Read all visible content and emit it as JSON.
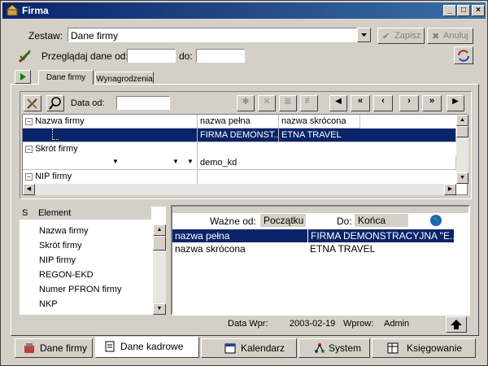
{
  "window": {
    "title": "Firma",
    "controls": [
      "minimize-icon",
      "maximize-icon",
      "close-icon"
    ]
  },
  "toolbar": {
    "zestaw_label": "Zestaw:",
    "zestaw_value": "Dane firmy",
    "save_label": "Zapisz",
    "cancel_label": "Anuluj",
    "browse_label": "Przeglądaj dane od:",
    "browse_from": "",
    "do_label": "do:",
    "browse_to": ""
  },
  "tabs": [
    "Dane firmy",
    "Wynagrodzenia"
  ],
  "inner_toolbar": {
    "data_od_label": "Data od:",
    "data_od_value": ""
  },
  "nav_buttons": [
    "first",
    "prev-page",
    "prev",
    "next",
    "next-page",
    "last"
  ],
  "tree": [
    {
      "label": "Nazwa firmy"
    },
    {
      "label": "Skrót firmy"
    },
    {
      "label": "NIP firmy"
    }
  ],
  "grid": {
    "columns": [
      "nazwa pełna",
      "nazwa skrócona"
    ],
    "rows": [
      {
        "full": "FIRMA DEMONST...",
        "short": "ETNA TRAVEL"
      },
      {
        "full": "demo_kd",
        "short": ""
      }
    ]
  },
  "element_list": {
    "col_s": "S",
    "col_element": "Element",
    "items": [
      "Nazwa firmy",
      "Skrót firmy",
      "NIP firmy",
      "REGON-EKD",
      "Numer PFRON firmy",
      "NKP"
    ]
  },
  "details": {
    "wazne_od_label": "Ważne od:",
    "wazne_od_value": "Początku",
    "do_label": "Do:",
    "do_value": "Końca",
    "rows": [
      {
        "key": "nazwa pełna",
        "value": "FIRMA DEMONSTRACYJNA \"E..."
      },
      {
        "key": "nazwa skrócona",
        "value": "ETNA TRAVEL"
      }
    ]
  },
  "status": {
    "data_wpr_label": "Data Wpr:",
    "data_wpr_value": "2003-02-19",
    "wprow_label": "Wprow:",
    "wprow_value": "Admin"
  },
  "bottom_tabs": [
    "Dane firmy",
    "Dane kadrowe",
    "Kalendarz",
    "System",
    "Księgowanie"
  ],
  "colors": {
    "selection": "#0a246a",
    "titlebar": "#0a246a",
    "face": "#d4d0c8"
  }
}
